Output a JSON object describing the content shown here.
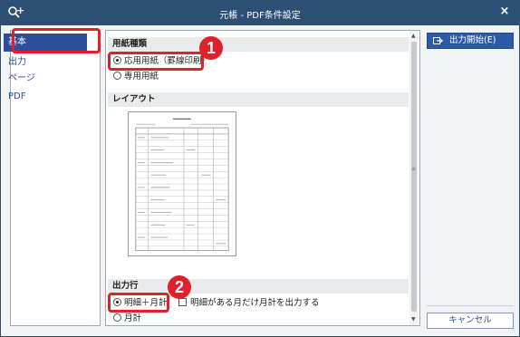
{
  "window": {
    "title": "元帳 - PDF条件設定",
    "close_symbol": "×"
  },
  "nav": {
    "items": [
      {
        "label": "基本",
        "active": true
      },
      {
        "label": "出力",
        "active": false
      },
      {
        "label": "ページ",
        "active": false
      },
      {
        "label": "PDF",
        "active": false
      }
    ]
  },
  "paper_type": {
    "heading": "用紙種類",
    "options": [
      {
        "label": "応用用紙（罫線印刷）",
        "selected": true
      },
      {
        "label": "専用用紙",
        "selected": false
      }
    ]
  },
  "layout": {
    "heading": "レイアウト"
  },
  "output_rows": {
    "heading": "出力行",
    "options": [
      {
        "label": "明細＋月計",
        "selected": true
      },
      {
        "label": "月計",
        "selected": false
      }
    ],
    "checkbox_label": "明細がある月だけ月計を出力する",
    "checkbox_checked": false
  },
  "callouts": [
    "1",
    "2"
  ],
  "buttons": {
    "start": "出力開始(E)",
    "cancel": "キャンセル"
  },
  "colors": {
    "titlebar": "#2d4f75",
    "nav_active": "#2c4f9c",
    "highlight_red": "#e0202b",
    "primary_button": "#2b5aa8"
  }
}
